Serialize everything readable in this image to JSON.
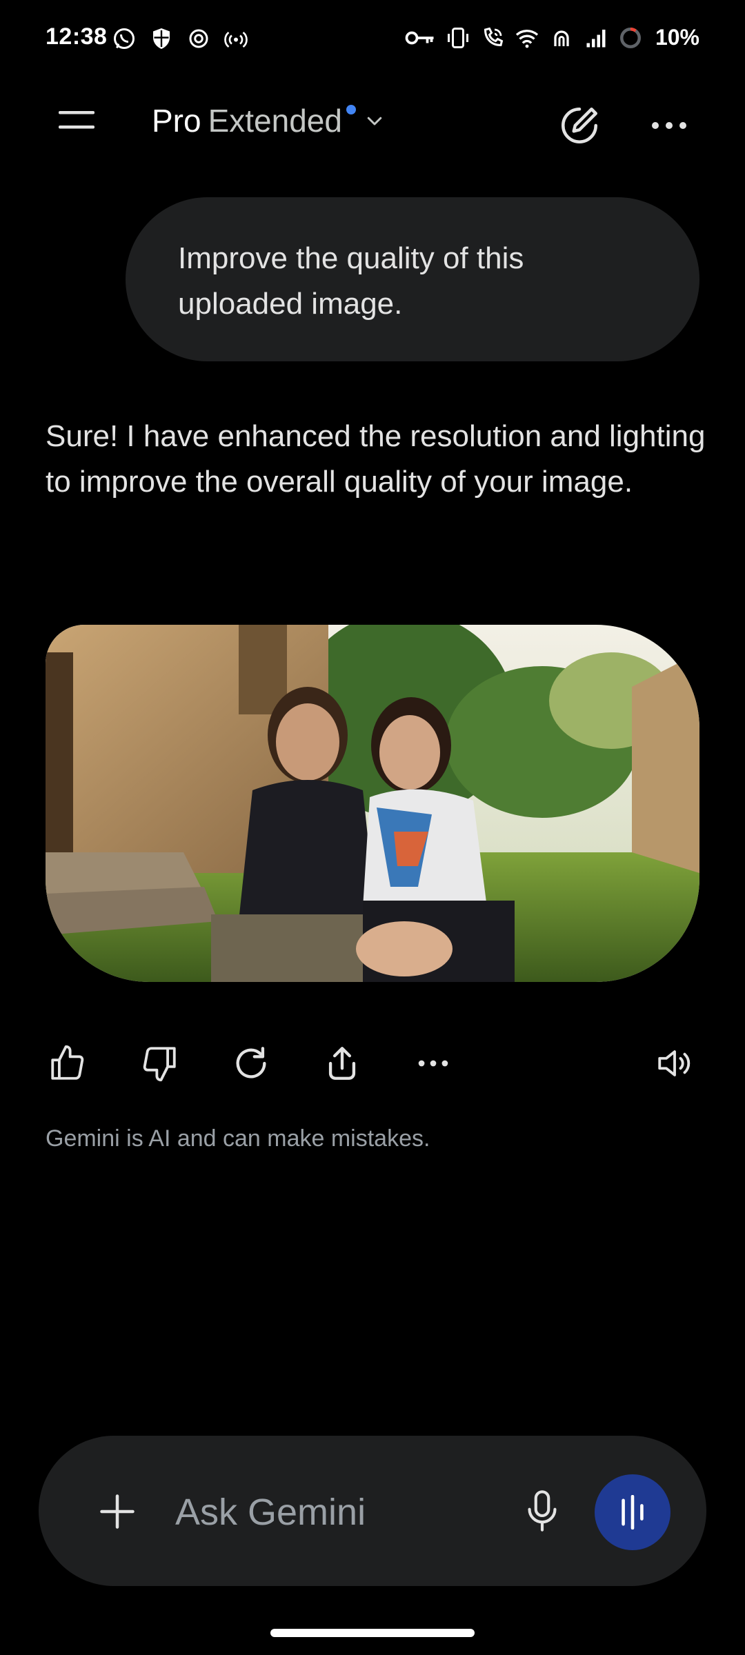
{
  "status_bar": {
    "time": "12:38",
    "battery": "10%",
    "icons_left": [
      "whatsapp-icon",
      "shield-icon",
      "chatgpt-icon",
      "hotspot-icon"
    ],
    "icons_right": [
      "key-icon",
      "vibrate-icon",
      "wifi-call-icon",
      "wifi-icon",
      "nfc-icon",
      "signal-icon",
      "battery-ring-icon"
    ]
  },
  "app_bar": {
    "model_primary": "Pro",
    "model_secondary": "Extended",
    "accent_dot_color": "#4285f4"
  },
  "conversation": {
    "user_message": "Improve the quality of this uploaded image.",
    "assistant_message": "Sure! I have enhanced the resolution and lighting to improve the overall quality of your image.",
    "image_alt": "Two smiling young women sitting together on grass in front of an old stone building"
  },
  "actions": [
    "thumbs-up-icon",
    "thumbs-down-icon",
    "regenerate-icon",
    "share-icon",
    "more-options-icon",
    "read-aloud-icon"
  ],
  "disclaimer": "Gemini is AI and can make mistakes.",
  "input": {
    "placeholder": "Ask Gemini",
    "value": ""
  },
  "colors": {
    "background": "#000000",
    "surface": "#1e1f20",
    "voice_button": "#1f3a93",
    "muted_text": "#9aa0a6"
  }
}
